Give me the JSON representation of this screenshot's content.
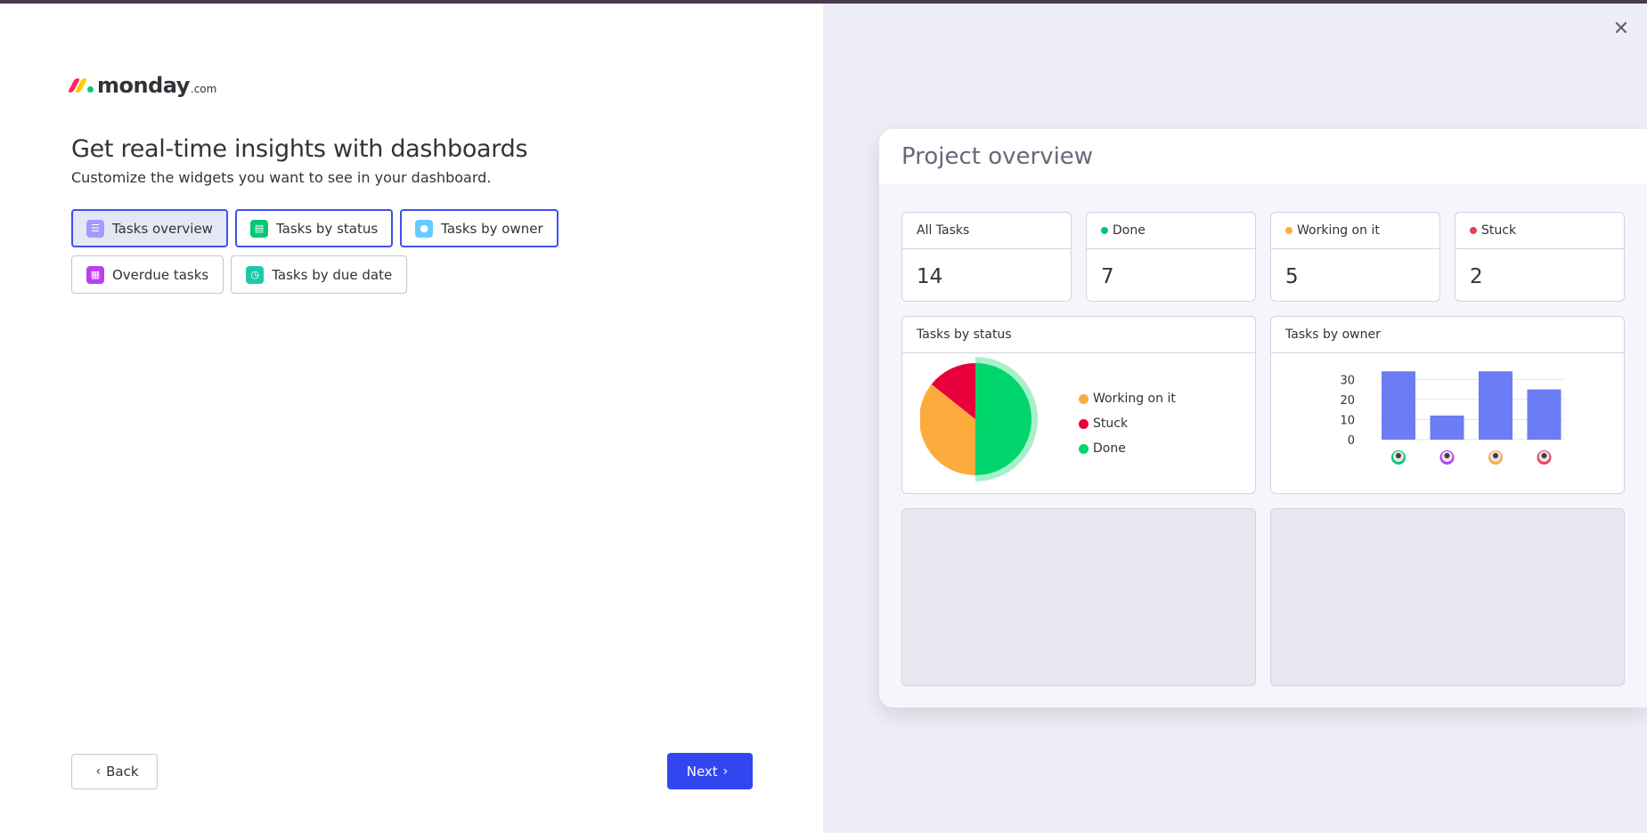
{
  "brand": {
    "name": "monday",
    "suffix": ".com",
    "colors": [
      "#fb275d",
      "#ffcc00",
      "#00ca72"
    ]
  },
  "heading": "Get real-time insights with dashboards",
  "subheading": "Customize the widgets you want to see in your dashboard.",
  "widgets": [
    {
      "label": "Tasks overview",
      "icon": "list-icon",
      "color": "#a29bff",
      "selected": true
    },
    {
      "label": "Tasks by status",
      "icon": "status-icon",
      "color": "#00c875",
      "selected": true
    },
    {
      "label": "Tasks by owner",
      "icon": "person-icon",
      "color": "#66ccff",
      "selected": true
    },
    {
      "label": "Overdue tasks",
      "icon": "calendar-icon",
      "color": "#bb3ef3",
      "selected": false
    },
    {
      "label": "Tasks by due date",
      "icon": "clock-icon",
      "color": "#1fc8a8",
      "selected": false
    }
  ],
  "nav": {
    "back_label": "Back",
    "next_label": "Next"
  },
  "preview": {
    "title": "Project overview",
    "stats": [
      {
        "label": "All Tasks",
        "value": "14",
        "color": ""
      },
      {
        "label": "Done",
        "value": "7",
        "color": "#00c875"
      },
      {
        "label": "Working on it",
        "value": "5",
        "color": "#fdab3d"
      },
      {
        "label": "Stuck",
        "value": "2",
        "color": "#e2445c"
      }
    ],
    "status_card_title": "Tasks by status",
    "owner_card_title": "Tasks by owner",
    "legend": [
      {
        "label": "Working on it",
        "color": "#fdab3d"
      },
      {
        "label": "Stuck",
        "color": "#e8003d"
      },
      {
        "label": "Done",
        "color": "#00d66b"
      }
    ]
  },
  "chart_data": [
    {
      "type": "pie",
      "title": "Tasks by status",
      "categories": [
        "Done",
        "Working on it",
        "Stuck"
      ],
      "values": [
        7,
        5,
        2
      ],
      "colors": [
        "#00d66b",
        "#fdab3d",
        "#e8003d"
      ],
      "legend_placement": "right"
    },
    {
      "type": "bar",
      "title": "Tasks by owner",
      "categories": [
        "owner-1",
        "owner-2",
        "owner-3",
        "owner-4"
      ],
      "values": [
        34,
        12,
        34,
        25
      ],
      "ylim": [
        0,
        35
      ],
      "ticks": [
        "30",
        "20",
        "10",
        "0"
      ],
      "tick_values": [
        30,
        20,
        10,
        0
      ],
      "color": "#6b7cf5",
      "avatar_colors": [
        "#00c875",
        "#bb3ef3",
        "#fdab3d",
        "#e2445c"
      ],
      "grid": true
    }
  ]
}
